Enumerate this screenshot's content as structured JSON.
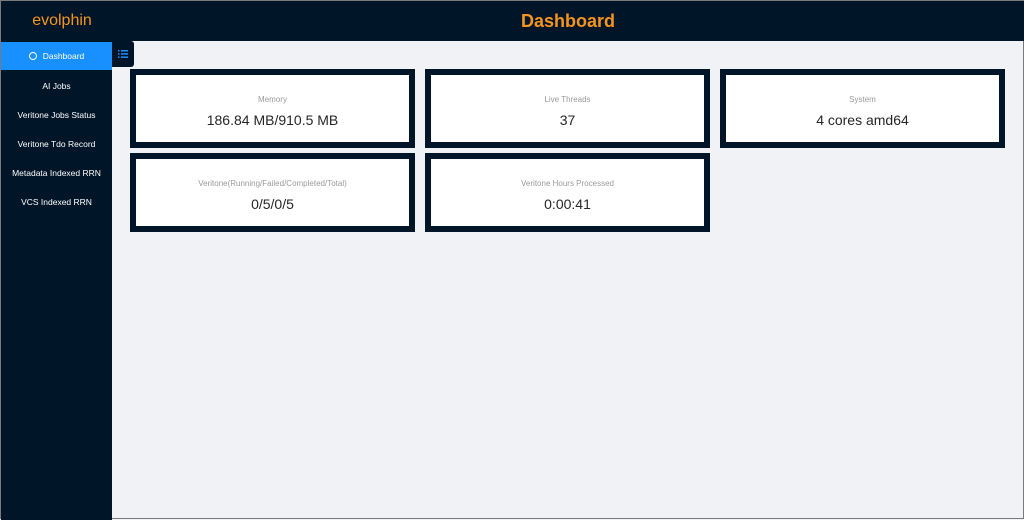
{
  "header": {
    "logo": "evolphin",
    "title": "Dashboard"
  },
  "sidebar": {
    "items": [
      {
        "label": "Dashboard",
        "active": true,
        "icon": "dashboard-icon"
      },
      {
        "label": "AI Jobs"
      },
      {
        "label": "Veritone Jobs Status"
      },
      {
        "label": "Veritone Tdo Record"
      },
      {
        "label": "Metadata Indexed RRN"
      },
      {
        "label": "VCS Indexed RRN"
      }
    ],
    "toggle_icon": "menu-list-icon"
  },
  "cards": [
    {
      "label": "Memory",
      "value": "186.84 MB/910.5 MB"
    },
    {
      "label": "Live Threads",
      "value": "37"
    },
    {
      "label": "System",
      "value": "4 cores amd64"
    },
    {
      "label": "Veritone(Running/Failed/Completed/Total)",
      "value": "0/5/0/5"
    },
    {
      "label": "Veritone Hours Processed",
      "value": "0:00:41"
    }
  ],
  "colors": {
    "navy": "#011528",
    "accent": "#f5951f",
    "active": "#1890ff",
    "background": "#f0f2f5"
  }
}
